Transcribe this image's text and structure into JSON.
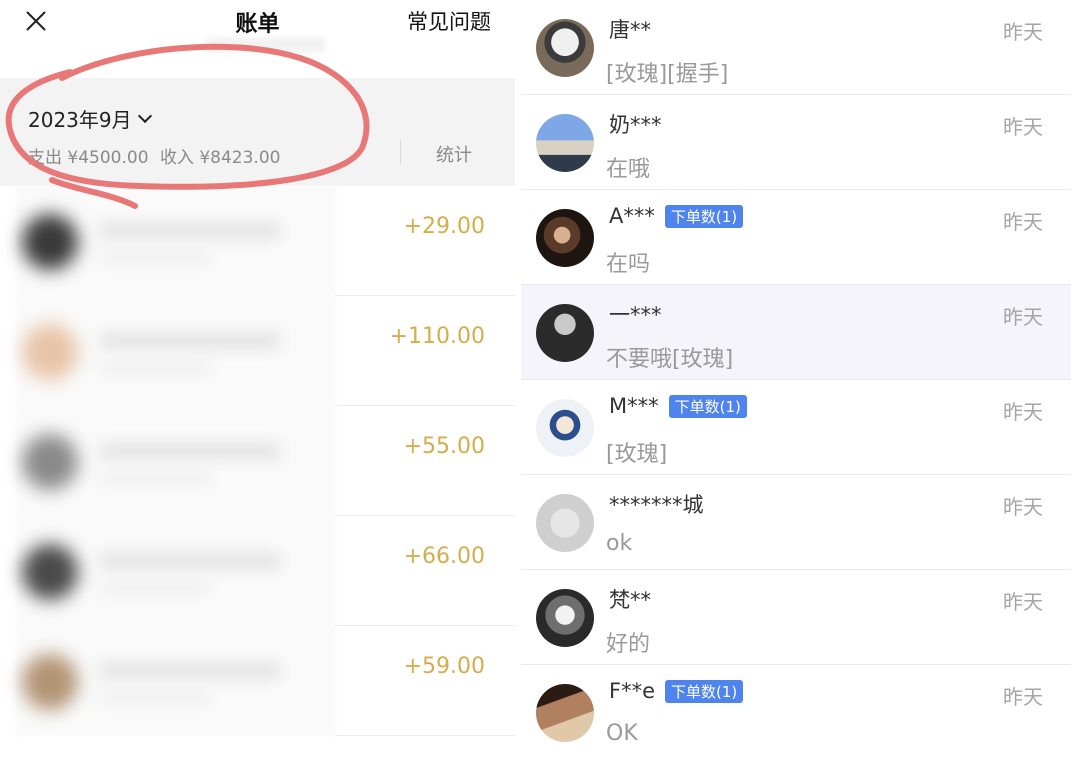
{
  "bill_panel": {
    "title": "账单",
    "faq_label": "常见问题",
    "month": "2023年9月",
    "expense": "支出 ¥4500.00",
    "income": "收入 ¥8423.00",
    "stats_label": "统计",
    "transactions": [
      {
        "amount": "+29.00",
        "avatar_color": "#3a3a3a"
      },
      {
        "amount": "+110.00",
        "avatar_color": "#e8c4a8"
      },
      {
        "amount": "+55.00",
        "avatar_color": "#8a8a8a"
      },
      {
        "amount": "+66.00",
        "avatar_color": "#4a4a4a"
      },
      {
        "amount": "+59.00",
        "avatar_color": "#b29474"
      }
    ],
    "amount_color": "#d4ad4c",
    "annotation_color": "#e87878"
  },
  "chat_panel": {
    "chats": [
      {
        "name": "唐**",
        "preview": "[玫瑰][握手]",
        "time": "昨天",
        "badge": ""
      },
      {
        "name": "奶***",
        "preview": "在哦",
        "time": "昨天",
        "badge": ""
      },
      {
        "name": "A***",
        "preview": "在吗",
        "time": "昨天",
        "badge": "下单数(1)"
      },
      {
        "name": "一***",
        "preview": "不要哦[玫瑰]",
        "time": "昨天",
        "badge": ""
      },
      {
        "name": "M***",
        "preview": "[玫瑰]",
        "time": "昨天",
        "badge": "下单数(1)"
      },
      {
        "name": "*******城",
        "preview": "ok",
        "time": "昨天",
        "badge": ""
      },
      {
        "name": "梵**",
        "preview": "好的",
        "time": "昨天",
        "badge": ""
      },
      {
        "name": "F**e",
        "preview": "OK",
        "time": "昨天",
        "badge": "下单数(1)"
      }
    ],
    "badge_color": "#4f84ee"
  }
}
